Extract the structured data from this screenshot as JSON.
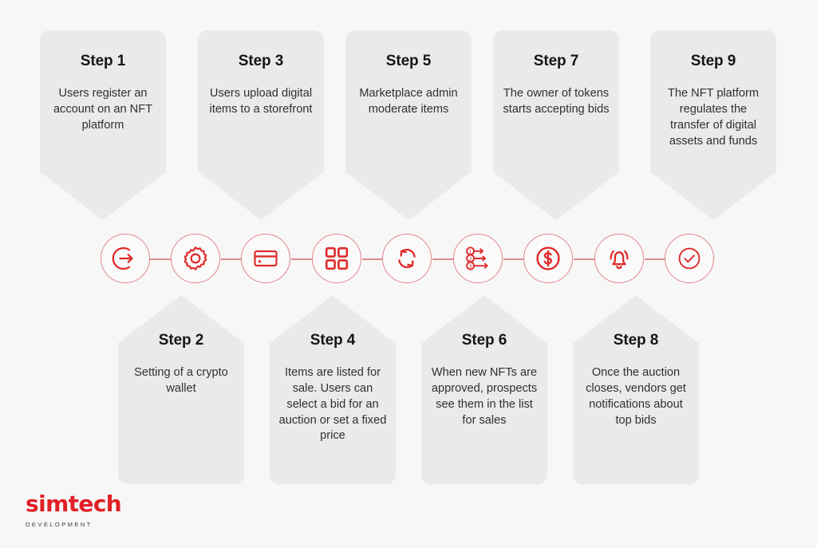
{
  "page": {
    "background_color": "#f7f7f7",
    "accent_color": "#e11f26",
    "card_fill_color": "#eaeaea",
    "connector_color": "#dd8c90"
  },
  "steps_top": [
    {
      "title": "Step 1",
      "body": "Users register an account on an NFT platform"
    },
    {
      "title": "Step 3",
      "body": "Users upload digital items to a storefront"
    },
    {
      "title": "Step 5",
      "body": "Marketplace admin moderate items"
    },
    {
      "title": "Step 7",
      "body": "The owner of tokens starts accepting bids"
    },
    {
      "title": "Step 9",
      "body": "The NFT platform regulates the transfer of digital assets and funds"
    }
  ],
  "steps_bottom": [
    {
      "title": "Step 2",
      "body": "Setting of a crypto wallet"
    },
    {
      "title": "Step 4",
      "body": "Items are listed for sale. Users can select a bid for an auction or set a fixed price"
    },
    {
      "title": "Step 6",
      "body": "When new NFTs are approved, prospects see them in the list for sales"
    },
    {
      "title": "Step 8",
      "body": "Once the auction closes, vendors get notifications about top bids"
    }
  ],
  "timeline_icons": [
    {
      "name": "login-arrow-icon",
      "step": "Step 1"
    },
    {
      "name": "gear-icon",
      "step": "Step 2"
    },
    {
      "name": "credit-card-icon",
      "step": "Step 3"
    },
    {
      "name": "grid-squares-icon",
      "step": "Step 4"
    },
    {
      "name": "refresh-sync-icon",
      "step": "Step 5"
    },
    {
      "name": "ranked-list-arrows-icon",
      "step": "Step 6"
    },
    {
      "name": "dollar-coin-icon",
      "step": "Step 7"
    },
    {
      "name": "bell-notification-icon",
      "step": "Step 8"
    },
    {
      "name": "check-circle-icon",
      "step": "Step 9"
    }
  ],
  "logo": {
    "word": "simtech",
    "sub": "DEVELOPMENT"
  }
}
